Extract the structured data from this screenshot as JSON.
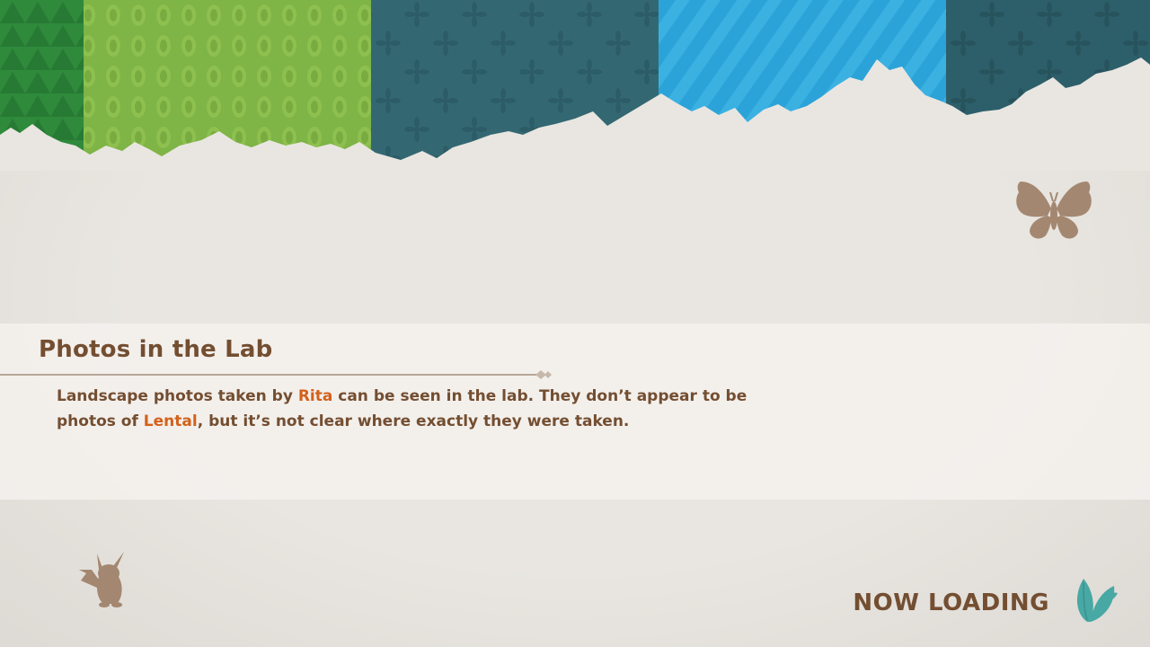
{
  "tip": {
    "title": "Photos in the Lab",
    "body": {
      "part1": "Landscape photos taken by ",
      "keyword1": "Rita",
      "part2": " can be seen in the lab. They don’t appear to be photos of ",
      "keyword2": "Lental",
      "part3": ", but it’s not clear where exactly they were taken."
    }
  },
  "loading": {
    "label": "NOW LOADING"
  },
  "icons": {
    "butterfly": "butterfly-silhouette-icon",
    "pikachu": "pikachu-silhouette-icon",
    "leaf": "leaf-loading-icon"
  },
  "colors": {
    "text_brown": "#744e31",
    "keyword_orange": "#d4611a",
    "silhouette": "#a48770",
    "leaf_teal": "#48a8a4",
    "band_dark_green": "#2f8a3c",
    "band_lime": "#7fb446",
    "band_teal": "#336872",
    "band_sky": "#2ba3d8",
    "band_deep_teal": "#2d5f6a"
  }
}
